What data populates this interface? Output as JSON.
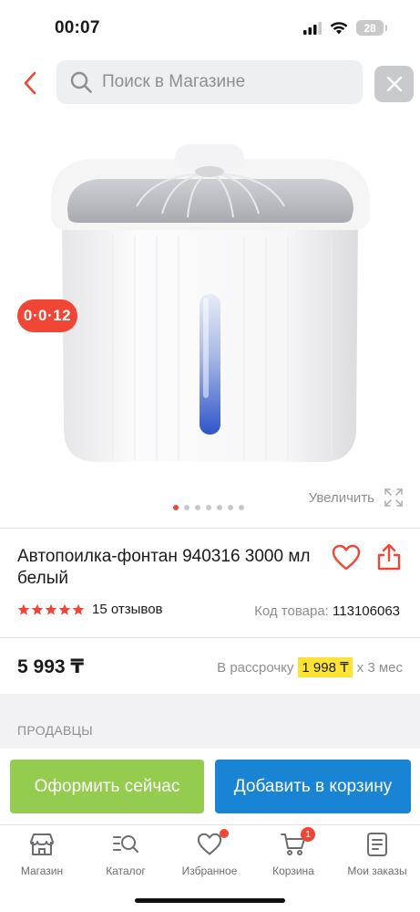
{
  "status_bar": {
    "time": "00:07",
    "battery": "28"
  },
  "search": {
    "placeholder": "Поиск в Магазине"
  },
  "gallery": {
    "promo_badge": "0·0·12",
    "zoom_label": "Увеличить",
    "image_count": 7,
    "active_index": 0
  },
  "product": {
    "title": "Автопоилка-фонтан 940316 3000 мл белый",
    "rating": 5,
    "reviews": "15 отзывов",
    "sku_label": "Код товара:",
    "sku": "113106063",
    "price": "5 993 ₸",
    "installment_prefix": "В рассрочку",
    "installment_amount": "1 998 ₸",
    "installment_suffix": "х 3 мес"
  },
  "sellers": {
    "heading": "ПРОДАВЦЫ"
  },
  "actions": {
    "buy_now": "Оформить сейчас",
    "add_to_cart": "Добавить в корзину"
  },
  "tabbar": {
    "items": [
      {
        "label": "Магазин",
        "icon": "store-icon"
      },
      {
        "label": "Каталог",
        "icon": "catalog-search-icon"
      },
      {
        "label": "Избранное",
        "icon": "heart-icon"
      },
      {
        "label": "Корзина",
        "icon": "cart-icon",
        "badge": "1"
      },
      {
        "label": "Мои заказы",
        "icon": "orders-icon"
      }
    ]
  },
  "colors": {
    "accent": "#f14635",
    "buy_now": "#93cc4e",
    "add_to_cart": "#1a84d4",
    "installment_highlight": "#ffe333"
  }
}
